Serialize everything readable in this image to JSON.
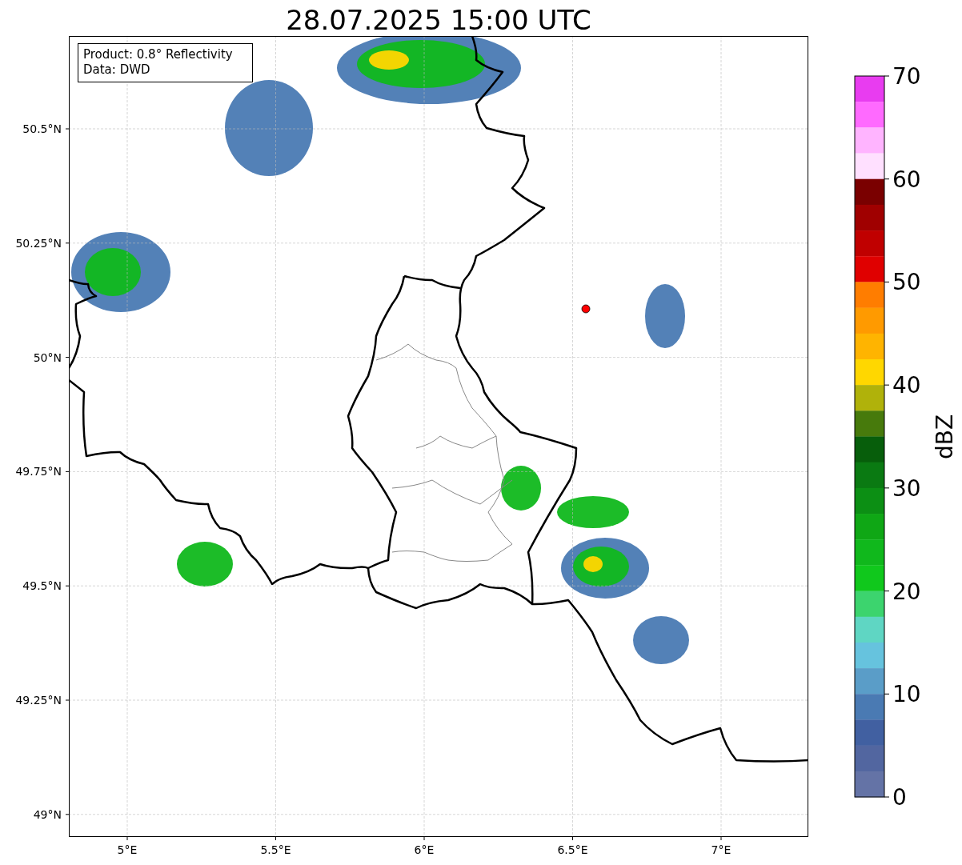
{
  "title": "28.07.2025 15:00 UTC",
  "legend": [
    "Product: 0.8° Reflectivity",
    "Data: DWD"
  ],
  "latitude_labels": [
    "50.5°N",
    "50.25°N",
    "50°N",
    "49.75°N",
    "49.5°N",
    "49.25°N",
    "49°N"
  ],
  "longitude_labels": [
    "5°E",
    "5.5°E",
    "6°E",
    "6.5°E",
    "7°E"
  ],
  "colorbar": {
    "label": "dBZ",
    "ticks": [
      "70",
      "60",
      "50",
      "40",
      "30",
      "20",
      "10",
      "0"
    ],
    "segments": [
      {
        "color": "#e83cf0"
      },
      {
        "color": "#ff6aff"
      },
      {
        "color": "#ffb4ff"
      },
      {
        "color": "#ffe0ff"
      },
      {
        "color": "#7a0000"
      },
      {
        "color": "#a00000"
      },
      {
        "color": "#c00000"
      },
      {
        "color": "#e00000"
      },
      {
        "color": "#ff7d00"
      },
      {
        "color": "#ff9a00"
      },
      {
        "color": "#ffb400"
      },
      {
        "color": "#ffd700"
      },
      {
        "color": "#b0b20a"
      },
      {
        "color": "#477a0c"
      },
      {
        "color": "#075e0b"
      },
      {
        "color": "#0a7a12"
      },
      {
        "color": "#0c8f14"
      },
      {
        "color": "#0fa715"
      },
      {
        "color": "#10b81c"
      },
      {
        "color": "#10c81c"
      },
      {
        "color": "#3cd46e"
      },
      {
        "color": "#5fd6c3"
      },
      {
        "color": "#66c3de"
      },
      {
        "color": "#5a9dc8"
      },
      {
        "color": "#4a7ab3"
      },
      {
        "color": "#4160a1"
      },
      {
        "color": "#5266a0"
      },
      {
        "color": "#6473a6"
      }
    ]
  }
}
